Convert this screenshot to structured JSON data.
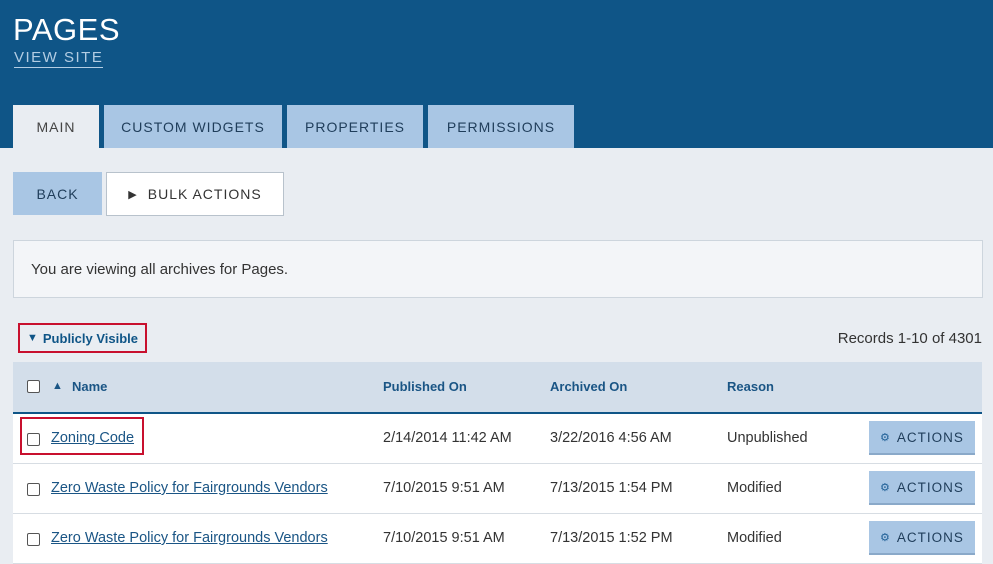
{
  "header": {
    "title": "PAGES",
    "view_site": "VIEW SITE"
  },
  "tabs": [
    {
      "label": "MAIN",
      "active": true
    },
    {
      "label": "CUSTOM WIDGETS",
      "active": false
    },
    {
      "label": "PROPERTIES",
      "active": false
    },
    {
      "label": "PERMISSIONS",
      "active": false
    }
  ],
  "toolbar": {
    "back_label": "BACK",
    "bulk_label": "BULK ACTIONS",
    "bulk_icon": "▶"
  },
  "notice": "You are viewing all archives for Pages.",
  "filter": {
    "icon": "▼",
    "label": "Publicly Visible"
  },
  "records": "Records 1-10 of 4301",
  "table": {
    "sort_icon": "▲",
    "columns": [
      "Name",
      "Published On",
      "Archived On",
      "Reason"
    ],
    "rows": [
      {
        "name": "Zoning Code",
        "published": "2/14/2014 11:42 AM",
        "archived": "3/22/2016 4:56 AM",
        "reason": "Unpublished",
        "action": "ACTIONS"
      },
      {
        "name": "Zero Waste Policy for Fairgrounds Vendors",
        "published": "7/10/2015 9:51 AM",
        "archived": "7/13/2015 1:54 PM",
        "reason": "Modified",
        "action": "ACTIONS"
      },
      {
        "name": "Zero Waste Policy for Fairgrounds Vendors",
        "published": "7/10/2015 9:51 AM",
        "archived": "7/13/2015 1:52 PM",
        "reason": "Modified",
        "action": "ACTIONS"
      }
    ]
  },
  "colors": {
    "header_bg": "#0f5587",
    "tab_bg": "#a9c6e4",
    "highlight": "#c8102e"
  }
}
